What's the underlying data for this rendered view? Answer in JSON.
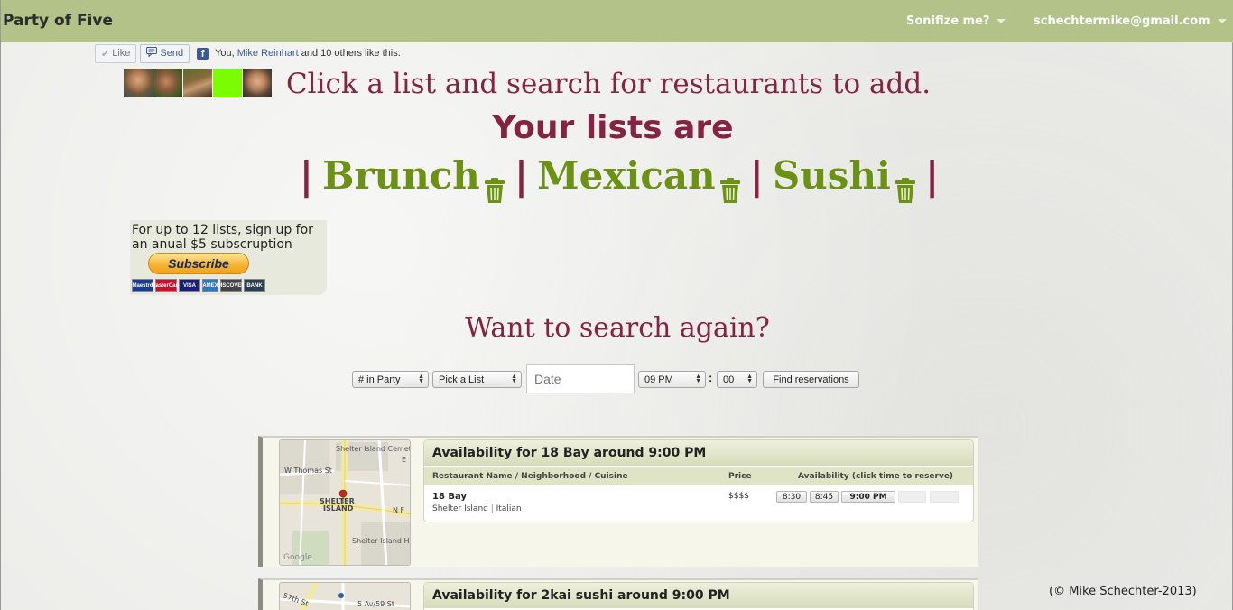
{
  "navbar": {
    "brand": "Party of Five",
    "sonifize": "Sonifize me?",
    "account": "schechtermike@gmail.com"
  },
  "facebook": {
    "like_label": "Like",
    "send_label": "Send",
    "you": "You, ",
    "friend": "Mike Reinhart",
    "others": " and 10 others like this."
  },
  "headline": "Click a list and search for restaurants to add.",
  "lists_heading": "Your lists are",
  "lists": [
    "Brunch",
    "Mexican",
    "Sushi"
  ],
  "pipe": "|",
  "subscribe": {
    "text": "For up to 12 lists, sign up for an anual $5 subscruption",
    "button": "Subscribe",
    "cards": [
      "Maestro",
      "MasterCard",
      "VISA",
      "AMEX",
      "DISCOVER",
      "BANK"
    ]
  },
  "search": {
    "heading": "Want to search again?",
    "party": "# in Party",
    "list": "Pick a List",
    "date_placeholder": "Date",
    "hour": "09 PM",
    "colon": ":",
    "minute": "00",
    "find": "Find reservations"
  },
  "results": [
    {
      "title": "Availability for 18 Bay around 9:00 PM",
      "col_name": "Restaurant Name / Neighborhood / Cuisine",
      "col_price": "Price",
      "col_avail": "Availability (click time to reserve)",
      "name": "18 Bay",
      "neighborhood": "Shelter Island",
      "sep": "|",
      "cuisine": "Italian",
      "price": "$$$$",
      "times": [
        "8:30",
        "8:45",
        "9:00 PM"
      ],
      "map_labels": {
        "cemetery": "Shelter Island Cemetery",
        "street1": "W Thomas St",
        "east": "E",
        "shelter": "SHELTER",
        "island": "ISLAND",
        "nf": "N F",
        "school": "Shelter Island High School",
        "google": "Google"
      }
    },
    {
      "title": "Availability for 2kai sushi around 9:00 PM",
      "map_labels": {
        "st57": "57th St",
        "av5": "5 Av/59 St"
      }
    }
  ],
  "footer": "(© Mike Schechter-2013)",
  "colors": {
    "navbar": "#b2c288",
    "heading": "#852344",
    "list_green": "#6b9212"
  }
}
